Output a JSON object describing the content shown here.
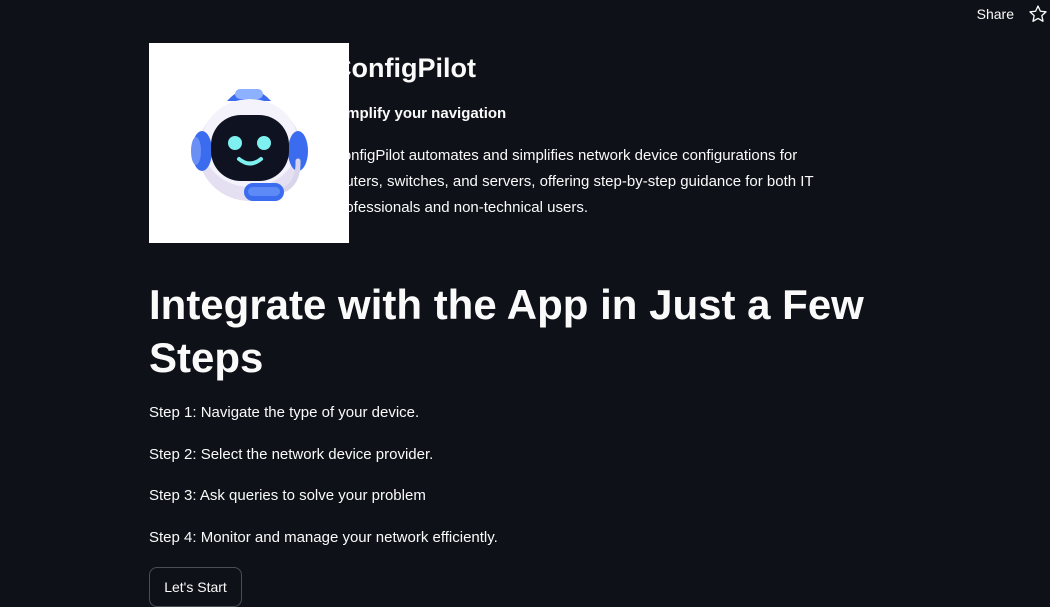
{
  "header": {
    "share_label": "Share"
  },
  "hero": {
    "title": "ConfigPilot",
    "tagline": "Simplify your navigation",
    "description": "ConfigPilot automates and simplifies network device configurations for routers, switches, and servers, offering step-by-step guidance for both IT professionals and non-technical users."
  },
  "main": {
    "heading": "Integrate with the App in Just a Few Steps",
    "steps": [
      "Step 1: Navigate the type of your device.",
      "Step 2: Select the network device provider.",
      "Step 3: Ask queries to solve your problem",
      "Step 4: Monitor and manage your network efficiently."
    ],
    "cta_label": "Let's Start"
  },
  "colors": {
    "background": "#0e1117",
    "text": "#fafafa",
    "robot_accent": "#3b6cf0",
    "robot_glow": "#7ff0f0"
  }
}
